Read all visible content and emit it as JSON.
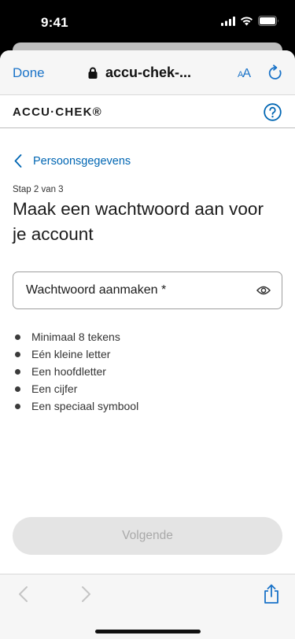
{
  "status": {
    "time": "9:41"
  },
  "browser": {
    "done_label": "Done",
    "url": "accu-chek-...",
    "text_size_label_small": "A",
    "text_size_label_large": "A",
    "accent": "#1a73c8"
  },
  "site": {
    "logo": "ACCU·CHEK®"
  },
  "main": {
    "back_label": "Persoonsgegevens",
    "step": "Stap 2 van 3",
    "title": "Maak een wachtwoord aan voor je account",
    "password_label": "Wachtwoord aanmaken *",
    "requirements": [
      "Minimaal 8 tekens",
      "Eén kleine letter",
      "Een hoofdletter",
      "Een cijfer",
      "Een speciaal symbool"
    ],
    "next_label": "Volgende",
    "link_color": "#0066b3"
  },
  "icons": {
    "status": [
      "signal-icon",
      "wifi-icon",
      "battery-icon"
    ],
    "browser": [
      "lock-icon",
      "reload-icon",
      "back-arrow-icon",
      "forward-arrow-icon",
      "share-icon"
    ],
    "site": [
      "help-icon",
      "chevron-left-icon",
      "eye-icon"
    ]
  }
}
